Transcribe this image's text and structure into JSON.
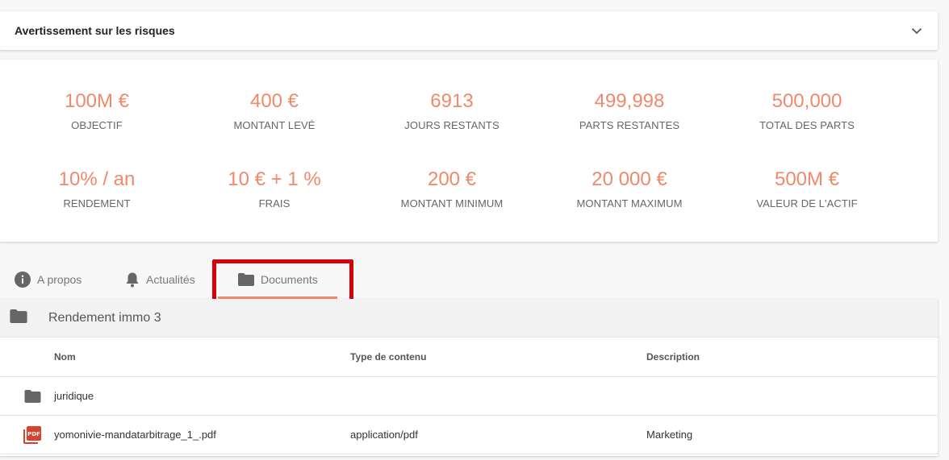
{
  "risk": {
    "title": "Avertissement sur les risques"
  },
  "stats": [
    {
      "value": "100M €",
      "label": "OBJECTIF"
    },
    {
      "value": "400 €",
      "label": "MONTANT LEVÉ"
    },
    {
      "value": "6913",
      "label": "JOURS RESTANTS"
    },
    {
      "value": "499,998",
      "label": "PARTS RESTANTES"
    },
    {
      "value": "500,000",
      "label": "TOTAL DES PARTS"
    },
    {
      "value": "10% / an",
      "label": "RENDEMENT"
    },
    {
      "value": "10 € + 1 %",
      "label": "FRAIS"
    },
    {
      "value": "200 €",
      "label": "MONTANT MINIMUM"
    },
    {
      "value": "20 000 €",
      "label": "MONTANT MAXIMUM"
    },
    {
      "value": "500M €",
      "label": "VALEUR DE L'ACTIF"
    }
  ],
  "tabs": [
    {
      "label": "A propos",
      "icon": "info-icon"
    },
    {
      "label": "Actualités",
      "icon": "bell-icon"
    },
    {
      "label": "Documents",
      "icon": "folder-icon",
      "active": true
    }
  ],
  "colors": {
    "accent": "#f0896b",
    "highlight": "#d4000a",
    "pdf": "#d9412f",
    "folder": "#666666"
  },
  "docs": {
    "folder": "Rendement immo 3",
    "columns": {
      "name": "Nom",
      "type": "Type de contenu",
      "description": "Description"
    },
    "rows": [
      {
        "icon": "folder-icon",
        "name": "juridique",
        "type": "",
        "description": ""
      },
      {
        "icon": "pdf-icon",
        "name": "yomonivie-mandatarbitrage_1_.pdf",
        "type": "application/pdf",
        "description": "Marketing"
      }
    ]
  }
}
